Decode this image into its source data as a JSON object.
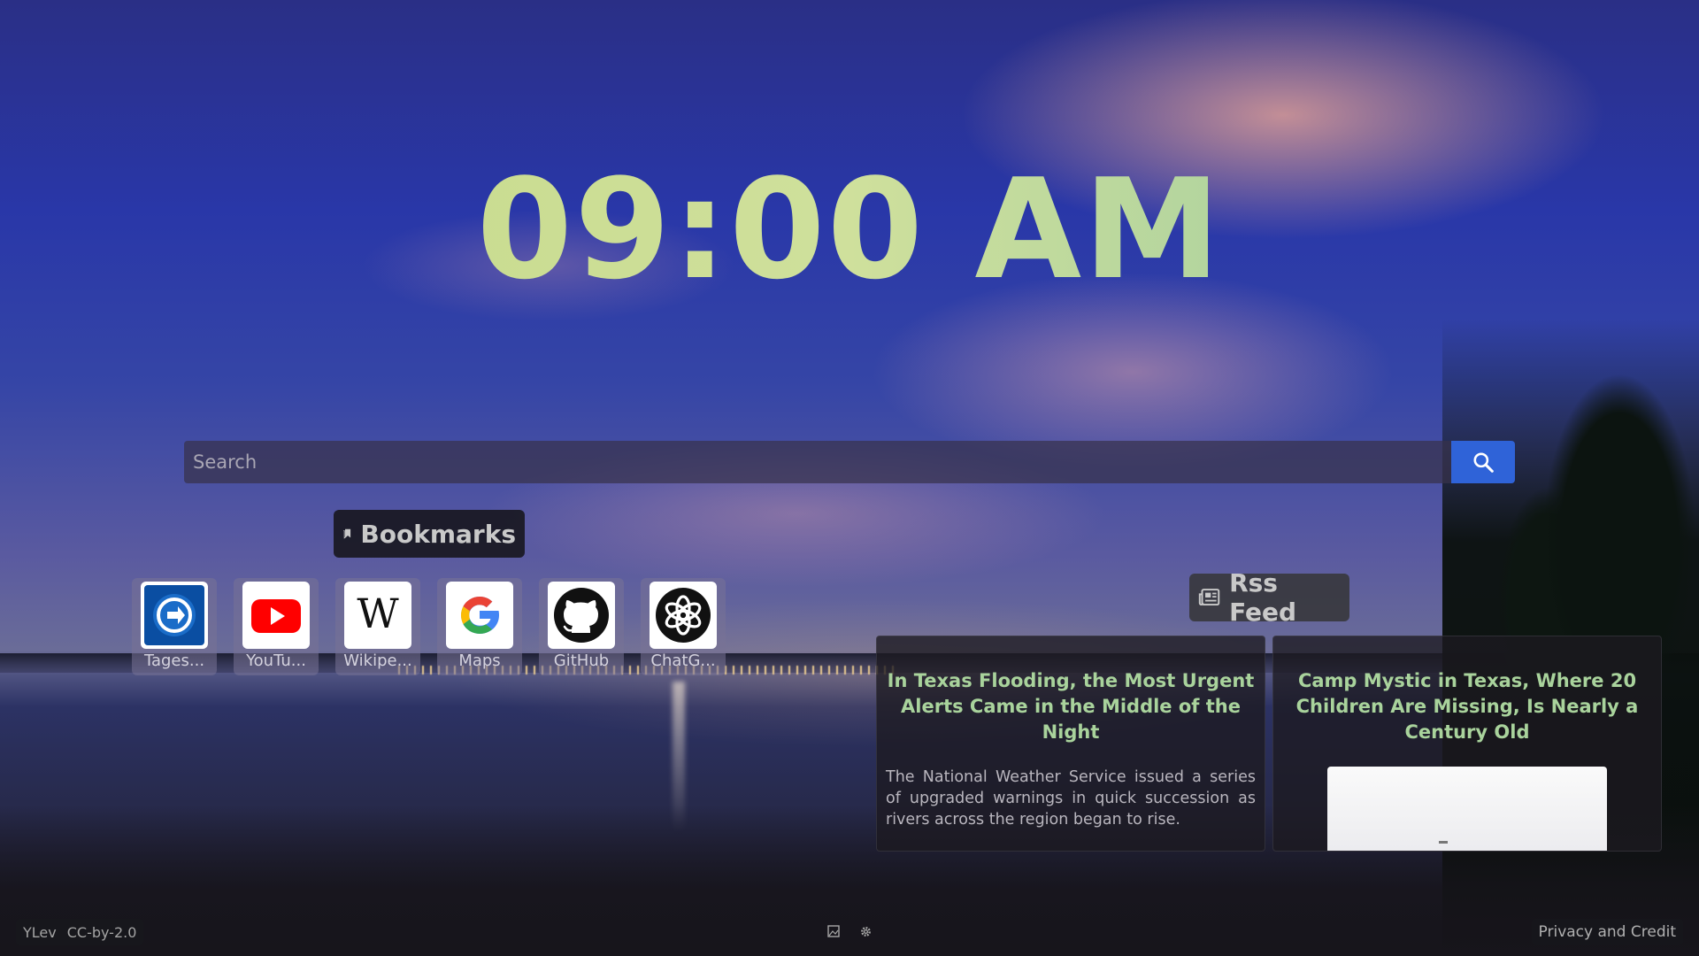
{
  "clock": {
    "time": "09:00 AM"
  },
  "search": {
    "placeholder": "Search",
    "value": ""
  },
  "bookmarks": {
    "title": "Bookmarks",
    "items": [
      {
        "label": "Tages...",
        "icon": "tagesschau-icon"
      },
      {
        "label": "YouTu...",
        "icon": "youtube-icon"
      },
      {
        "label": "Wikipe...",
        "icon": "wikipedia-icon"
      },
      {
        "label": "Maps",
        "icon": "google-icon"
      },
      {
        "label": "GitHub",
        "icon": "github-icon"
      },
      {
        "label": "ChatG...",
        "icon": "chatgpt-icon"
      }
    ]
  },
  "rss": {
    "title": "Rss Feed",
    "items": [
      {
        "title": "In Texas Flooding, the Most Urgent Alerts Came in the Middle of the Night",
        "description": "The National Weather Service issued a series of upgraded warnings in quick succession as rivers across the region began to rise."
      },
      {
        "title": "Camp Mystic in Texas, Where 20 Children Are Missing, Is Nearly a Century Old",
        "description": ""
      }
    ]
  },
  "footer": {
    "author": "YLev",
    "license": "CC-by-2.0",
    "privacy": "Privacy and Credit"
  },
  "colors": {
    "clock": "#cbdc8a",
    "search_button": "#2f63d8",
    "feed_title": "#a9d39c"
  }
}
